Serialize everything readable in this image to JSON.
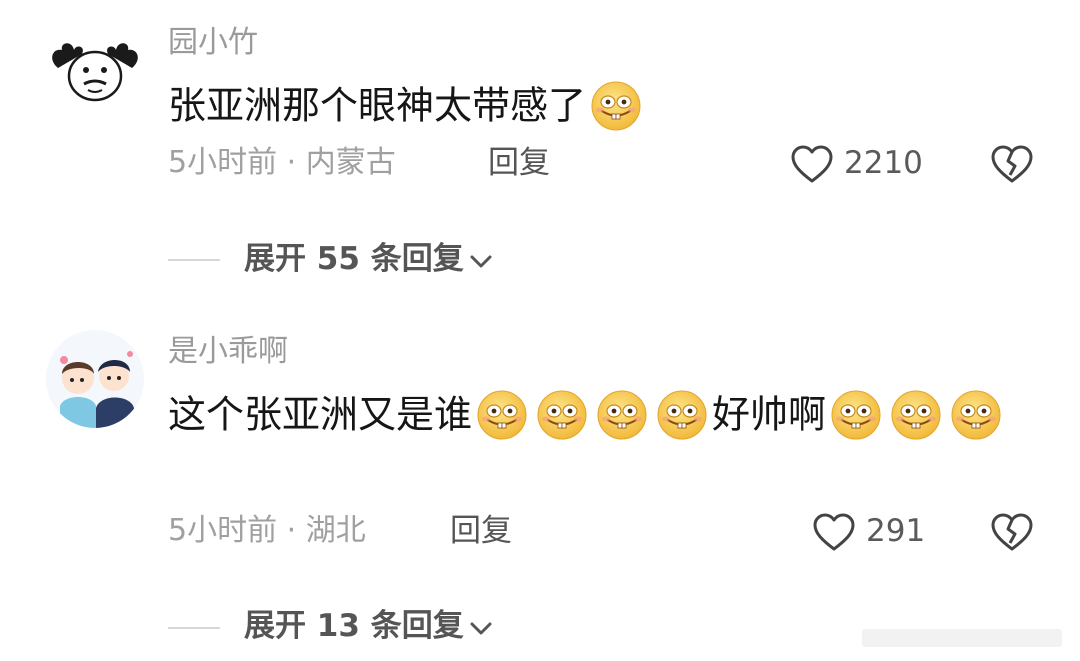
{
  "comments": [
    {
      "username": "园小竹",
      "text_parts": [
        "张亚洲那个眼神太带感了"
      ],
      "emoji_count_after": 1,
      "time_location": "5小时前 · 内蒙古",
      "reply_label": "回复",
      "likes": "2210",
      "expand_label": "展开 55 条回复"
    },
    {
      "username": "是小乖啊",
      "text_first": "这个张亚洲又是谁",
      "text_second": "好帅啊",
      "time_location": "5小时前 · 湖北",
      "reply_label": "回复",
      "likes": "291",
      "expand_label": "展开 13 条回复"
    }
  ],
  "icons": {
    "like": "heart-outline-icon",
    "dislike": "broken-heart-icon",
    "emoji": "grin-emoji-icon",
    "expand": "chevron-down-icon"
  },
  "colors": {
    "text": "#161616",
    "muted": "#9a9a9a",
    "emoji_face": "#f7c948"
  }
}
